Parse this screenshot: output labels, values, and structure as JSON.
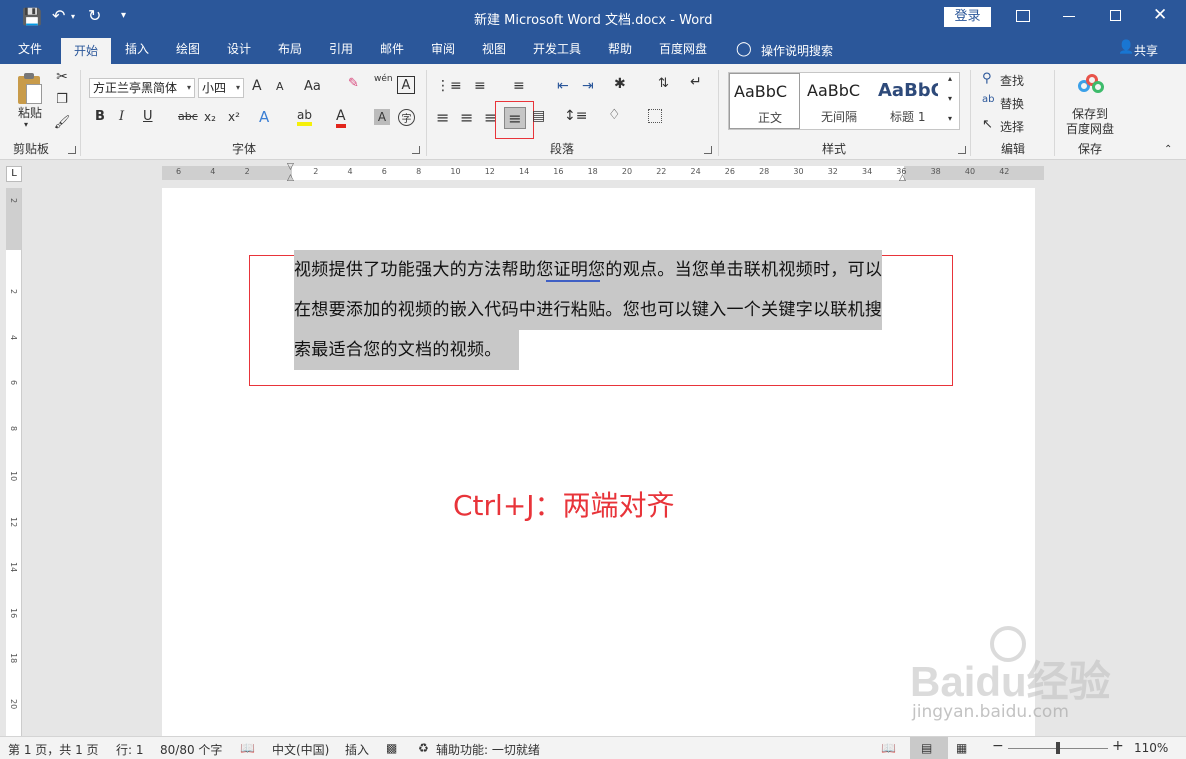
{
  "window": {
    "title": "新建 Microsoft Word 文档.docx  -  Word",
    "login": "登录",
    "qat_more": "▾"
  },
  "tabs": [
    "文件",
    "开始",
    "插入",
    "绘图",
    "设计",
    "布局",
    "引用",
    "邮件",
    "审阅",
    "视图",
    "开发工具",
    "帮助",
    "百度网盘"
  ],
  "active_tab": "开始",
  "tell_me": "操作说明搜索",
  "share": "共享",
  "ribbon": {
    "clipboard": {
      "paste": "粘贴",
      "label": "剪贴板"
    },
    "font": {
      "name": "方正兰亭黑简体",
      "size": "小四",
      "label": "字体",
      "grow": "A",
      "shrink": "A",
      "case": "Aa",
      "phonetic": "wén",
      "border": "A",
      "bold": "B",
      "italic": "I",
      "underline": "U",
      "strike": "abc",
      "sub": "x₂",
      "sup": "x²",
      "effects": "A",
      "highlight": "ab",
      "color": "A",
      "shade": "A",
      "enclose": "字"
    },
    "paragraph": {
      "label": "段落"
    },
    "styles": {
      "label": "样式",
      "items": [
        {
          "preview": "AaBbC",
          "name": "正文"
        },
        {
          "preview": "AaBbC",
          "name": "无间隔"
        },
        {
          "preview": "AaBbC",
          "name": "标题 1"
        }
      ]
    },
    "editing": {
      "label": "编辑",
      "find": "查找",
      "replace": "替换",
      "select": "选择"
    },
    "save": {
      "label": "保存",
      "line1": "保存到",
      "line2": "百度网盘"
    }
  },
  "ruler": {
    "hticks": [
      "6",
      "4",
      "2",
      "",
      "2",
      "4",
      "6",
      "8",
      "10",
      "12",
      "14",
      "16",
      "18",
      "20",
      "22",
      "24",
      "26",
      "28",
      "30",
      "32",
      "34",
      "36",
      "38",
      "40",
      "42"
    ],
    "vticks": [
      "2",
      "",
      "2",
      "4",
      "6",
      "8",
      "10",
      "12",
      "14",
      "16",
      "18",
      "20"
    ]
  },
  "document": {
    "lines": [
      "视频提供了功能强大的方法帮助您证明您的观点。当您单击联机视频时，可以",
      "在想要添加的视频的嵌入代码中进行粘贴。您也可以键入一个关键字以联机搜",
      "索最适合您的文档的视频。"
    ],
    "annotation": "Ctrl+J：两端对齐",
    "annotation_color": "#e8343a",
    "watermark_brand": "Baidu经验",
    "watermark_url": "jingyan.baidu.com"
  },
  "status": {
    "page": "第 1 页，共 1 页",
    "line": "行: 1",
    "words": "80/80 个字",
    "lang": "中文(中国)",
    "mode": "插入",
    "access": "辅助功能: 一切就绪",
    "zoom": "110%",
    "zoom_fraction": 0.48
  },
  "colors": {
    "brand": "#2b579a",
    "highlight_box": "#e8343a",
    "selection": "#c8c8c8"
  }
}
